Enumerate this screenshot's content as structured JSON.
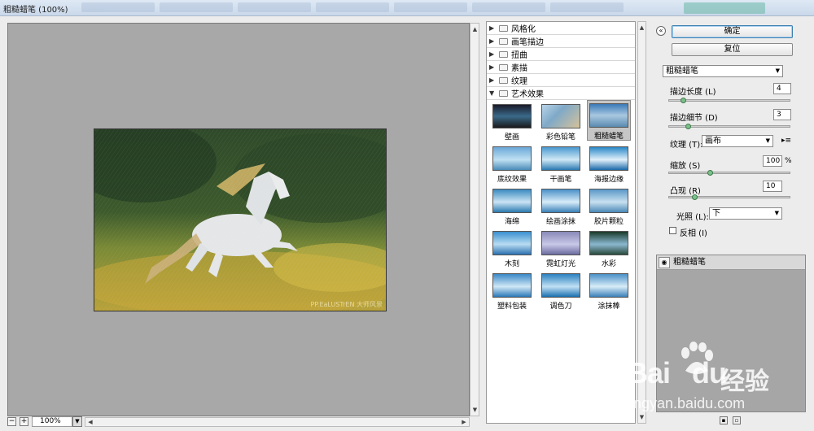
{
  "window": {
    "title": "粗糙蜡笔 (100%)"
  },
  "preview": {
    "zoom_level": "100%",
    "image_watermark": "PP.EaLUSTrEN 大师风景"
  },
  "filter_gallery": {
    "categories": [
      {
        "label": "风格化",
        "expanded": false
      },
      {
        "label": "画笔描边",
        "expanded": false
      },
      {
        "label": "扭曲",
        "expanded": false
      },
      {
        "label": "素描",
        "expanded": false
      },
      {
        "label": "纹理",
        "expanded": false
      },
      {
        "label": "艺术效果",
        "expanded": true
      }
    ],
    "artistic_filters": [
      {
        "label": "壁画",
        "selected": false
      },
      {
        "label": "彩色铅笔",
        "selected": false
      },
      {
        "label": "粗糙蜡笔",
        "selected": true
      },
      {
        "label": "底纹效果",
        "selected": false
      },
      {
        "label": "干画笔",
        "selected": false
      },
      {
        "label": "海报边缘",
        "selected": false
      },
      {
        "label": "海绵",
        "selected": false
      },
      {
        "label": "绘画涂抹",
        "selected": false
      },
      {
        "label": "胶片颗粒",
        "selected": false
      },
      {
        "label": "木刻",
        "selected": false
      },
      {
        "label": "霓虹灯光",
        "selected": false
      },
      {
        "label": "水彩",
        "selected": false
      },
      {
        "label": "塑料包装",
        "selected": false
      },
      {
        "label": "调色刀",
        "selected": false
      },
      {
        "label": "涂抹棒",
        "selected": false
      }
    ]
  },
  "buttons": {
    "ok_label": "确定",
    "reset_label": "复位"
  },
  "settings": {
    "filter_select": "粗糙蜡笔",
    "stroke_length": {
      "label": "描边长度 (L)",
      "value": "4",
      "fraction": 0.1
    },
    "stroke_detail": {
      "label": "描边细节 (D)",
      "value": "3",
      "fraction": 0.14
    },
    "texture": {
      "label": "纹理 (T):",
      "value": "画布"
    },
    "scaling": {
      "label": "缩放 (S)",
      "value": "100",
      "unit": "%",
      "fraction": 0.33
    },
    "relief": {
      "label": "凸现 (R)",
      "value": "10",
      "fraction": 0.2
    },
    "light": {
      "label": "光照 (L):",
      "value": "下"
    },
    "invert": {
      "label": "反相 (I)",
      "checked": false
    }
  },
  "layers": [
    {
      "name": "粗糙蜡笔",
      "visible": true
    }
  ],
  "watermark": {
    "logo": "Bai",
    "logo2": "du",
    "jingyan": "经验",
    "url": "jingyan.baidu.com"
  },
  "colors": {
    "selection_bg": "#c6c6c6",
    "primary_border": "#3c7fb1",
    "canvas_gray": "#a8a8a8",
    "slider_thumb": "#7bbf8a"
  }
}
